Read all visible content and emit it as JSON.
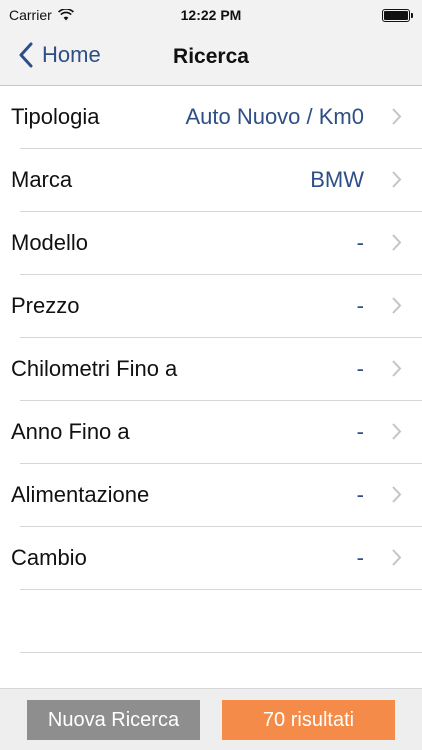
{
  "status_bar": {
    "carrier": "Carrier",
    "time": "12:22 PM",
    "wifi_icon": "wifi-icon",
    "battery_icon": "battery-icon"
  },
  "nav": {
    "back_label": "Home",
    "title": "Ricerca"
  },
  "rows": [
    {
      "label": "Tipologia",
      "value": "Auto Nuovo / Km0"
    },
    {
      "label": "Marca",
      "value": "BMW"
    },
    {
      "label": "Modello",
      "value": "-"
    },
    {
      "label": "Prezzo",
      "value": "-"
    },
    {
      "label": "Chilometri Fino a",
      "value": "-"
    },
    {
      "label": "Anno Fino a",
      "value": "-"
    },
    {
      "label": "Alimentazione",
      "value": "-"
    },
    {
      "label": "Cambio",
      "value": "-"
    }
  ],
  "buttons": {
    "new_search": "Nuova Ricerca",
    "results": "70 risultati"
  },
  "colors": {
    "accent": "#2e4f86",
    "new_search_bg": "#8e8e8e",
    "results_bg": "#f58b48"
  }
}
